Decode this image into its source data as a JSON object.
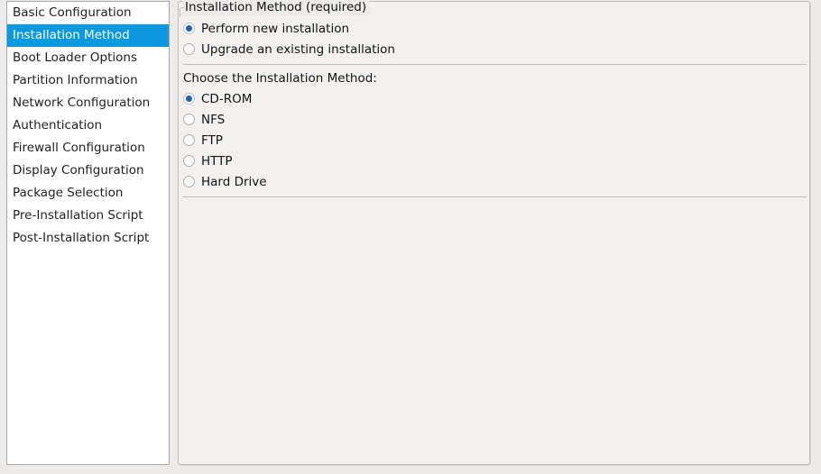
{
  "window": {
    "background_color": "#edebe9",
    "panel_background_color": "#f2f1ef",
    "accent_color": "#0b9ae0",
    "radio_dot_color": "#1c63b8"
  },
  "sidebar": {
    "name": "configuration-section-list",
    "selected_index": 1,
    "items": [
      {
        "label": "Basic Configuration",
        "selected": false
      },
      {
        "label": "Installation Method",
        "selected": true
      },
      {
        "label": "Boot Loader Options",
        "selected": false
      },
      {
        "label": "Partition Information",
        "selected": false
      },
      {
        "label": "Network Configuration",
        "selected": false
      },
      {
        "label": "Authentication",
        "selected": false
      },
      {
        "label": "Firewall Configuration",
        "selected": false
      },
      {
        "label": "Display Configuration",
        "selected": false
      },
      {
        "label": "Package Selection",
        "selected": false
      },
      {
        "label": "Pre-Installation Script",
        "selected": false
      },
      {
        "label": "Post-Installation Script",
        "selected": false
      }
    ]
  },
  "panel": {
    "frame_label": "Installation Method (required)",
    "install_type": {
      "options": [
        {
          "label": "Perform new installation",
          "selected": true
        },
        {
          "label": "Upgrade an existing installation",
          "selected": false
        }
      ]
    },
    "method_heading": "Choose the Installation Method:",
    "method": {
      "options": [
        {
          "label": "CD-ROM",
          "selected": true
        },
        {
          "label": "NFS",
          "selected": false
        },
        {
          "label": "FTP",
          "selected": false
        },
        {
          "label": "HTTP",
          "selected": false
        },
        {
          "label": "Hard Drive",
          "selected": false
        }
      ]
    }
  }
}
